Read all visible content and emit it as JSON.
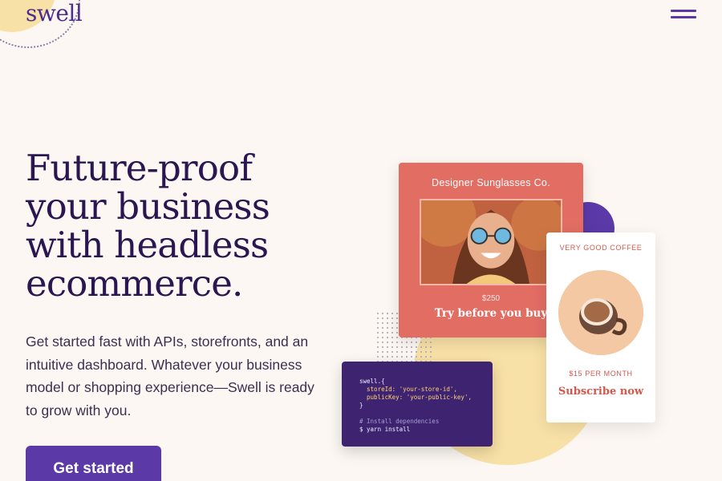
{
  "header": {
    "logo_text": "swell",
    "menu_icon": "hamburger-menu-icon"
  },
  "hero": {
    "title": "Future-proof your business with headless ecommerce.",
    "body": "Get started fast with APIs, storefronts, and an intuitive dashboard. Whatever your business model or shopping experience—Swell is ready to grow with you.",
    "cta_label": "Get started"
  },
  "product_card": {
    "title": "Designer Sunglasses Co.",
    "price": "$250",
    "cta": "Try before you buy"
  },
  "coffee_card": {
    "title": "VERY GOOD COFFEE",
    "price": "$15 PER MONTH",
    "cta": "Subscribe now"
  },
  "code_card": {
    "lines": [
      "swell.{",
      "  storeId: 'your-store-id',",
      "  publicKey: 'your-public-key',",
      "}",
      "",
      "# Install dependencies",
      "$ yarn install"
    ]
  },
  "colors": {
    "background": "#fcf7f3",
    "brand_purple": "#5b3aa8",
    "heading": "#2a1650",
    "coral": "#e16d63",
    "yellow": "#f8e1a6"
  }
}
